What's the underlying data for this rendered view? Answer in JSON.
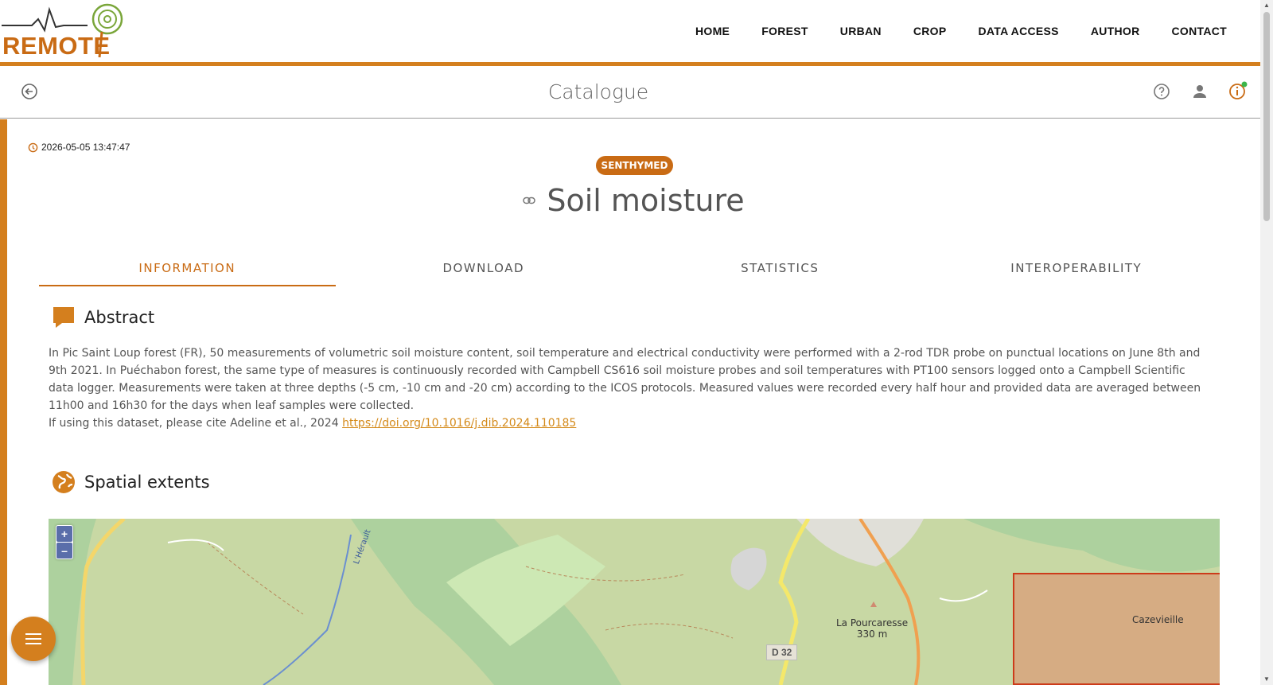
{
  "brand": {
    "logo_text": "REMOTE TREE"
  },
  "nav": {
    "items": [
      "HOME",
      "FOREST",
      "URBAN",
      "CROP",
      "DATA ACCESS",
      "AUTHOR",
      "CONTACT"
    ]
  },
  "subbar": {
    "title": "Catalogue",
    "icons": [
      "back-arrow-icon",
      "help-icon",
      "user-icon",
      "info-icon"
    ]
  },
  "record": {
    "timestamp": "2026-05-05 13:47:47",
    "badge": "SENTHYMED",
    "title": "Soil moisture"
  },
  "tabs": [
    {
      "label": "INFORMATION",
      "active": true
    },
    {
      "label": "DOWNLOAD",
      "active": false
    },
    {
      "label": "STATISTICS",
      "active": false
    },
    {
      "label": "INTEROPERABILITY",
      "active": false
    }
  ],
  "abstract": {
    "heading": "Abstract",
    "body": "In Pic Saint Loup forest (FR), 50 measurements of volumetric soil moisture content, soil temperature and electrical conductivity were performed with a 2-rod TDR probe on punctual locations on June 8th and 9th 2021. In Puéchabon forest, the same type of measures is continuously recorded with Campbell CS616 soil moisture probes and soil temperatures with PT100 sensors logged onto a Campbell Scientific data logger. Measurements were taken at three depths (-5 cm, -10 cm and -20 cm) according to the ICOS protocols. Measured values were recorded every half hour and provided data are averaged between 11h00 and 16h30 for the days when leaf samples were collected.",
    "cite_prefix": "If using this dataset, please cite Adeline et al., 2024 ",
    "cite_link": "https://doi.org/10.1016/j.dib.2024.110185"
  },
  "spatial": {
    "heading": "Spatial extents",
    "zoom_in": "+",
    "zoom_out": "–",
    "labels": {
      "river": "L'Hérault",
      "peak_name": "La Pourcaresse",
      "peak_alt": "330 m",
      "road": "D 32",
      "village": "Cazevieille"
    }
  },
  "colors": {
    "accent": "#d47f1e",
    "extent": "#cc3b1a"
  }
}
